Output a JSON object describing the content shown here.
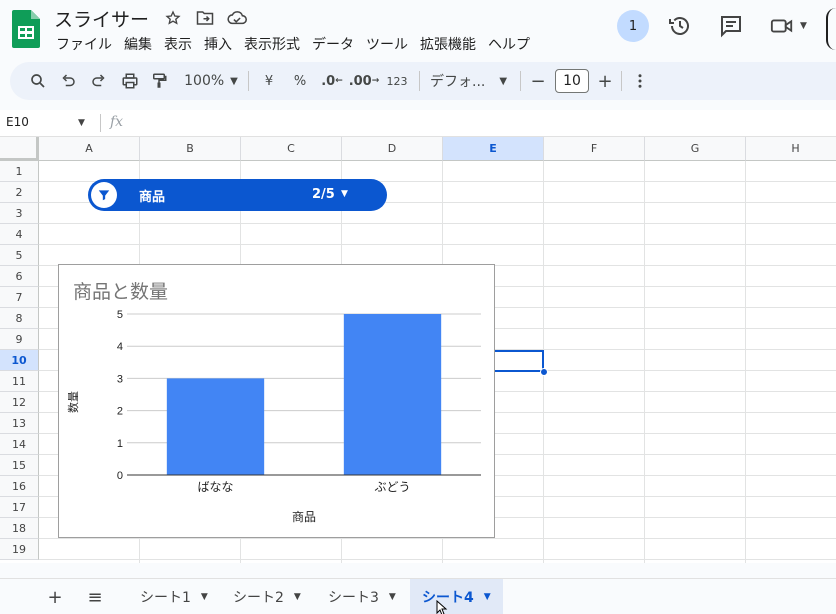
{
  "app": {
    "doc_title": "スライサー",
    "brand_color": "#0f9d58"
  },
  "menu": [
    "ファイル",
    "編集",
    "表示",
    "挿入",
    "表示形式",
    "データ",
    "ツール",
    "拡張機能",
    "ヘルプ"
  ],
  "header": {
    "presence_count": "1"
  },
  "toolbar": {
    "zoom": "100%",
    "currency": "¥",
    "percent": "%",
    "dec_decrease": ".0",
    "dec_increase": ".00",
    "number_format": "123",
    "font_family": "デフォ...",
    "font_size": "10",
    "minus": "−",
    "plus": "+"
  },
  "formula_bar": {
    "name_box": "E10",
    "fx_label": "fx"
  },
  "columns": [
    "A",
    "B",
    "C",
    "D",
    "E",
    "F",
    "G",
    "H"
  ],
  "rows": [
    "1",
    "2",
    "3",
    "4",
    "5",
    "6",
    "7",
    "8",
    "9",
    "10",
    "11",
    "12",
    "13",
    "14",
    "15",
    "16",
    "17",
    "18",
    "19"
  ],
  "selected": {
    "column": "E",
    "row": "10"
  },
  "slicer": {
    "label": "商品",
    "count": "2/5"
  },
  "chart_data": {
    "type": "bar",
    "title": "商品と数量",
    "categories": [
      "ばなな",
      "ぶどう"
    ],
    "values": [
      3,
      5
    ],
    "xlabel": "商品",
    "ylabel": "数量",
    "ylim": [
      0,
      5
    ],
    "yticks": [
      "0",
      "1",
      "2",
      "3",
      "4",
      "5"
    ],
    "grid": true,
    "bar_color": "#4285f4"
  },
  "sheets": {
    "add_label": "+",
    "list_label": "≡",
    "tabs": [
      "シート1",
      "シート2",
      "シート3",
      "シート4"
    ],
    "active_index": 3
  }
}
